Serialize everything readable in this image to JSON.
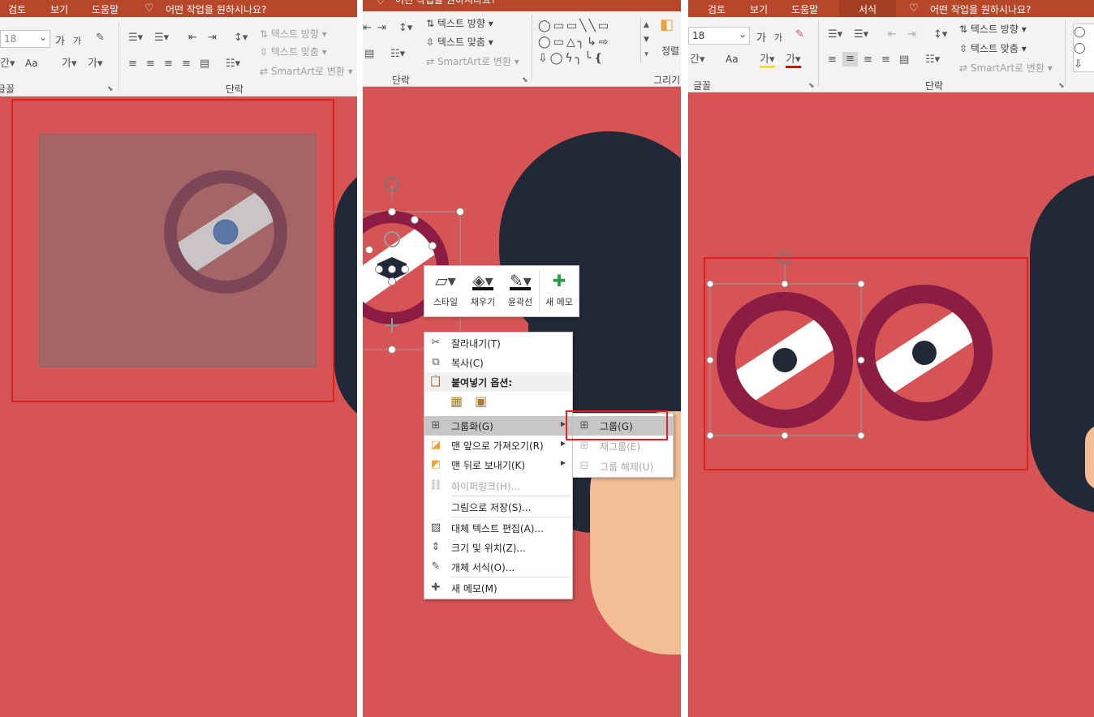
{
  "panel1": {
    "menu": [
      "검토",
      "보기",
      "도움말"
    ],
    "tell_me": "어떤 작업을 원하시나요?",
    "font_size": "18",
    "font_size_up": "가",
    "font_size_down": "가",
    "font_color_label": "가",
    "char_spacing": "Aa",
    "highlight_label": "가",
    "text_direction": "텍스트 방향",
    "align_text": "텍스트 맞춤",
    "smartart": "SmartArt로 변환",
    "group_font": "글꼴",
    "group_paragraph": "단락"
  },
  "panel2": {
    "tell_me": "어떤 작업을 원하시나요?",
    "text_direction": "텍스트 방향",
    "align_text": "텍스트 맞춤",
    "smartart": "SmartArt로 변환",
    "group_paragraph": "단락",
    "group_drawing": "그리기",
    "arrange": "정렬",
    "mini_toolbar": [
      "스타일",
      "채우기",
      "윤곽선",
      "새 메모"
    ],
    "context_menu": {
      "cut": "잘라내기(T)",
      "copy": "복사(C)",
      "paste_options": "붙여넣기 옵션:",
      "group": "그룹화(G)",
      "bring_front": "맨 앞으로 가져오기(R)",
      "send_back": "맨 뒤로 보내기(K)",
      "hyperlink": "하이퍼링크(H)...",
      "save_picture": "그림으로 저장(S)...",
      "alt_text": "대체 텍스트 편집(A)...",
      "size_position": "크기 및 위치(Z)...",
      "format_object": "개체 서식(O)...",
      "new_comment": "새 메모(M)"
    },
    "submenu": {
      "group": "그룹(G)",
      "regroup": "재그룹(E)",
      "ungroup": "그룹 해제(U)"
    }
  },
  "panel3": {
    "menu": [
      "검토",
      "보기",
      "도움말",
      "서식"
    ],
    "tell_me": "어떤 작업을 원하시나요?",
    "font_size": "18",
    "font_size_up": "가",
    "font_size_down": "가",
    "char_spacing": "Aa",
    "highlight_label": "가",
    "font_color_label": "가",
    "text_direction": "텍스트 방향",
    "align_text": "텍스트 맞춤",
    "smartart": "SmartArt로 변환",
    "group_font": "글꼴",
    "group_paragraph": "단락"
  },
  "colors": {
    "menubar": "#b7472a",
    "ribbon": "#f3f3f3",
    "slide": "#d75455",
    "dark": "#212838",
    "ring": "#8b1c43",
    "ring_faded": "#7d4656",
    "highlight_box": "#e02020",
    "skin": "#f3bd96"
  }
}
